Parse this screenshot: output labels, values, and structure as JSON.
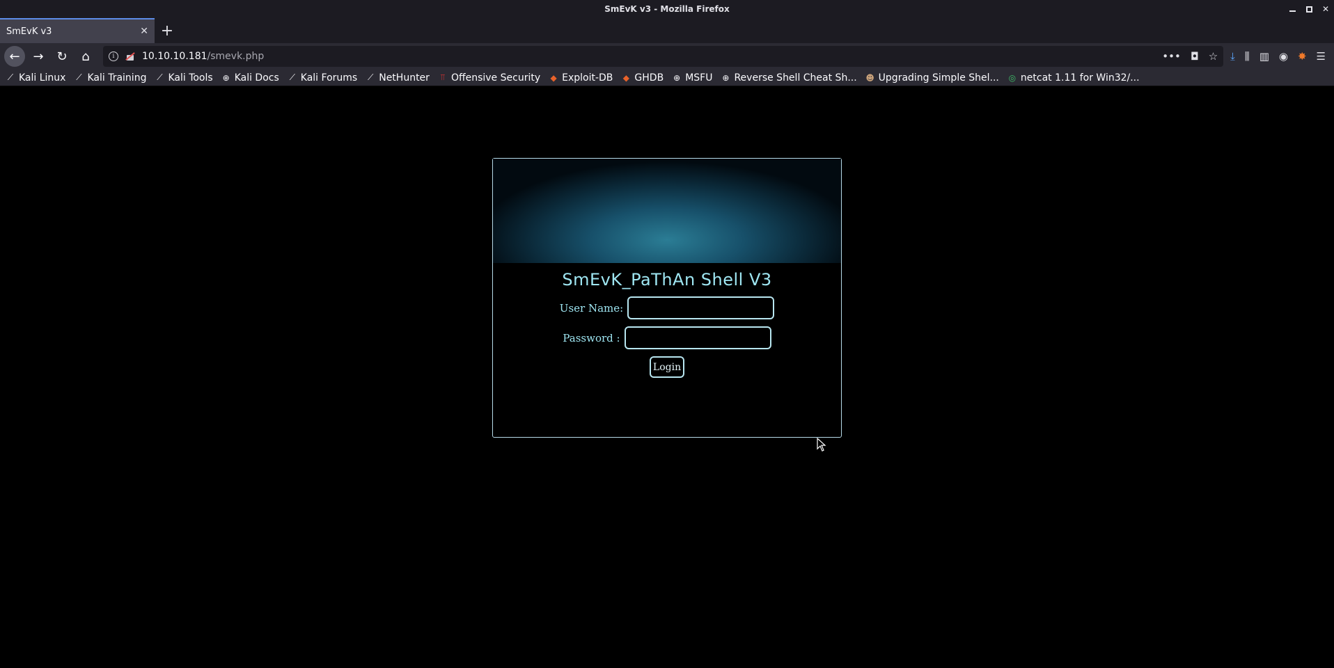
{
  "window": {
    "title": "SmEvK v3 - Mozilla Firefox"
  },
  "tabs": [
    {
      "label": "SmEvK v3",
      "active": true
    }
  ],
  "urlbar": {
    "host": "10.10.10.181",
    "path": "/smevk.php"
  },
  "bookmarks": [
    {
      "label": "Kali Linux",
      "icon": "kali-dragon-icon"
    },
    {
      "label": "Kali Training",
      "icon": "kali-dragon-icon"
    },
    {
      "label": "Kali Tools",
      "icon": "kali-dragon-icon"
    },
    {
      "label": "Kali Docs",
      "icon": "globe-icon"
    },
    {
      "label": "Kali Forums",
      "icon": "kali-dragon-icon"
    },
    {
      "label": "NetHunter",
      "icon": "kali-dragon-icon"
    },
    {
      "label": "Offensive Security",
      "icon": "offsec-icon"
    },
    {
      "label": "Exploit-DB",
      "icon": "exploit-db-icon"
    },
    {
      "label": "GHDB",
      "icon": "ghdb-icon"
    },
    {
      "label": "MSFU",
      "icon": "globe-icon"
    },
    {
      "label": "Reverse Shell Cheat Sh...",
      "icon": "globe-icon"
    },
    {
      "label": "Upgrading Simple Shel...",
      "icon": "avatar-icon"
    },
    {
      "label": "netcat 1.11 for Win32/...",
      "icon": "netcat-icon"
    }
  ],
  "page": {
    "heading": "SmEvK_PaThAn Shell V3",
    "username_label": "User Name:",
    "password_label": "Password :",
    "username_value": "",
    "password_value": "",
    "login_label": "Login"
  },
  "colors": {
    "accent": "#9fe6f2",
    "border": "#b8e6f0",
    "background": "#000000"
  }
}
